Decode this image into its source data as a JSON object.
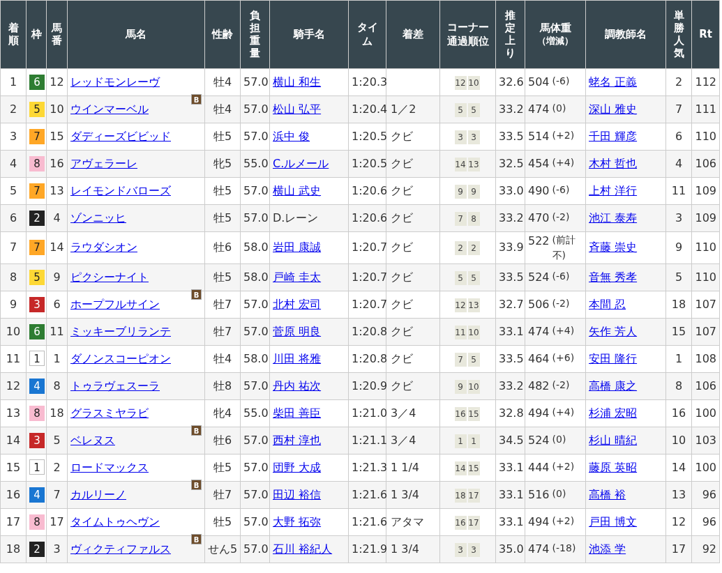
{
  "header": [
    {
      "label": "着順"
    },
    {
      "label": "枠"
    },
    {
      "label": "馬番"
    },
    {
      "label": "馬名"
    },
    {
      "label": "性齢"
    },
    {
      "label": "負担重量"
    },
    {
      "label": "騎手名"
    },
    {
      "label": "タイム"
    },
    {
      "label": "着差"
    },
    {
      "label": "コーナー通過順位"
    },
    {
      "label": "推定上り"
    },
    {
      "label": "馬体重",
      "sub": "（増減）"
    },
    {
      "label": "調教師名"
    },
    {
      "label": "単勝人気"
    },
    {
      "label": "Rt"
    }
  ],
  "rows": [
    {
      "place": "1",
      "frame": "6",
      "color": "#2e7d32",
      "number": "12",
      "horse": "レッドモンレーヴ",
      "sex_age": "牡4",
      "weight": "57.0",
      "jockey": "横山 和生",
      "jockey_linked": true,
      "time": "1:20.3",
      "corners": [
        "12",
        "10"
      ],
      "last_3f": "32.6",
      "body_weight": "504",
      "weight_change": "(-6)",
      "trainer": "蛯名 正義",
      "popularity": "2",
      "rating": "112"
    },
    {
      "place": "2",
      "frame": "5",
      "color": "#fdd835",
      "number": "10",
      "horse": "ウインマーベル",
      "blinkers": "B",
      "sex_age": "牡4",
      "weight": "57.0",
      "jockey": "松山 弘平",
      "jockey_linked": true,
      "time": "1:20.4",
      "margin": "1／2",
      "corners": [
        "5",
        "5"
      ],
      "last_3f": "33.2",
      "body_weight": "474",
      "weight_change": "(0)",
      "trainer": "深山 雅史",
      "popularity": "7",
      "rating": "111"
    },
    {
      "place": "3",
      "frame": "7",
      "color": "#ffa726",
      "number": "15",
      "horse": "ダディーズビビッド",
      "sex_age": "牡5",
      "weight": "57.0",
      "jockey": "浜中 俊",
      "jockey_linked": true,
      "time": "1:20.5",
      "margin": "クビ",
      "corners": [
        "3",
        "3"
      ],
      "last_3f": "33.5",
      "body_weight": "514",
      "weight_change": "(+2)",
      "trainer": "千田 輝彦",
      "popularity": "6",
      "rating": "110"
    },
    {
      "place": "4",
      "frame": "8",
      "color": "#f8bbd0",
      "number": "16",
      "horse": "アヴェラーレ",
      "sex_age": "牝5",
      "weight": "55.0",
      "jockey": "C.ルメール",
      "jockey_linked": true,
      "time": "1:20.5",
      "margin": "クビ",
      "corners": [
        "14",
        "13"
      ],
      "last_3f": "32.5",
      "body_weight": "454",
      "weight_change": "(+4)",
      "trainer": "木村 哲也",
      "popularity": "4",
      "rating": "106"
    },
    {
      "place": "5",
      "frame": "7",
      "color": "#ffa726",
      "number": "13",
      "horse": "レイモンドバローズ",
      "sex_age": "牡5",
      "weight": "57.0",
      "jockey": "横山 武史",
      "jockey_linked": true,
      "time": "1:20.6",
      "margin": "クビ",
      "corners": [
        "9",
        "9"
      ],
      "last_3f": "33.0",
      "body_weight": "490",
      "weight_change": "(-6)",
      "trainer": "上村 洋行",
      "popularity": "11",
      "rating": "109"
    },
    {
      "place": "6",
      "frame": "2",
      "color": "#222222",
      "number": "4",
      "horse": "ゾンニッヒ",
      "sex_age": "牡5",
      "weight": "57.0",
      "jockey": "D.レーン",
      "jockey_linked": false,
      "time": "1:20.6",
      "margin": "クビ",
      "corners": [
        "7",
        "8"
      ],
      "last_3f": "33.2",
      "body_weight": "470",
      "weight_change": "(-2)",
      "trainer": "池江 泰寿",
      "popularity": "3",
      "rating": "109"
    },
    {
      "place": "7",
      "frame": "7",
      "color": "#ffa726",
      "number": "14",
      "horse": "ラウダシオン",
      "sex_age": "牡6",
      "weight": "58.0",
      "jockey": "岩田 康誠",
      "jockey_linked": true,
      "time": "1:20.7",
      "margin": "クビ",
      "corners": [
        "2",
        "2"
      ],
      "last_3f": "33.9",
      "body_weight": "522",
      "weight_change": "(前計不)",
      "trainer": "斉藤 崇史",
      "popularity": "9",
      "rating": "110"
    },
    {
      "place": "8",
      "frame": "5",
      "color": "#fdd835",
      "number": "9",
      "horse": "ピクシーナイト",
      "sex_age": "牡5",
      "weight": "58.0",
      "jockey": "戸崎 圭太",
      "jockey_linked": true,
      "time": "1:20.7",
      "margin": "クビ",
      "corners": [
        "5",
        "5"
      ],
      "last_3f": "33.5",
      "body_weight": "524",
      "weight_change": "(-6)",
      "trainer": "音無 秀孝",
      "popularity": "5",
      "rating": "110"
    },
    {
      "place": "9",
      "frame": "3",
      "color": "#c62828",
      "number": "6",
      "horse": "ホープフルサイン",
      "blinkers": "B",
      "sex_age": "牡7",
      "weight": "57.0",
      "jockey": "北村 宏司",
      "jockey_linked": true,
      "time": "1:20.7",
      "margin": "クビ",
      "corners": [
        "12",
        "13"
      ],
      "last_3f": "32.7",
      "body_weight": "506",
      "weight_change": "(-2)",
      "trainer": "本間 忍",
      "popularity": "18",
      "rating": "107"
    },
    {
      "place": "10",
      "frame": "6",
      "color": "#2e7d32",
      "number": "11",
      "horse": "ミッキーブリランテ",
      "sex_age": "牡7",
      "weight": "57.0",
      "jockey": "菅原 明良",
      "jockey_linked": true,
      "time": "1:20.8",
      "margin": "クビ",
      "corners": [
        "11",
        "10"
      ],
      "last_3f": "33.1",
      "body_weight": "474",
      "weight_change": "(+4)",
      "trainer": "矢作 芳人",
      "popularity": "15",
      "rating": "107"
    },
    {
      "place": "11",
      "frame": "1",
      "color": "#ffffff",
      "number": "1",
      "horse": "ダノンスコーピオン",
      "sex_age": "牡4",
      "weight": "58.0",
      "jockey": "川田 将雅",
      "jockey_linked": true,
      "time": "1:20.8",
      "margin": "クビ",
      "corners": [
        "7",
        "5"
      ],
      "last_3f": "33.5",
      "body_weight": "464",
      "weight_change": "(+6)",
      "trainer": "安田 隆行",
      "popularity": "1",
      "rating": "108"
    },
    {
      "place": "12",
      "frame": "4",
      "color": "#1976d2",
      "number": "8",
      "horse": "トゥラヴェスーラ",
      "sex_age": "牡8",
      "weight": "57.0",
      "jockey": "丹内 祐次",
      "jockey_linked": true,
      "time": "1:20.9",
      "margin": "クビ",
      "corners": [
        "9",
        "10"
      ],
      "last_3f": "33.2",
      "body_weight": "482",
      "weight_change": "(-2)",
      "trainer": "高橋 康之",
      "popularity": "8",
      "rating": "106"
    },
    {
      "place": "13",
      "frame": "8",
      "color": "#f8bbd0",
      "number": "18",
      "horse": "グラスミヤラビ",
      "sex_age": "牝4",
      "weight": "55.0",
      "jockey": "柴田 善臣",
      "jockey_linked": true,
      "time": "1:21.0",
      "margin": "3／4",
      "corners": [
        "16",
        "15"
      ],
      "last_3f": "32.8",
      "body_weight": "494",
      "weight_change": "(+4)",
      "trainer": "杉浦 宏昭",
      "popularity": "16",
      "rating": "100"
    },
    {
      "place": "14",
      "frame": "3",
      "color": "#c62828",
      "number": "5",
      "horse": "ベレヌス",
      "blinkers": "B",
      "sex_age": "牡6",
      "weight": "57.0",
      "jockey": "西村 淳也",
      "jockey_linked": true,
      "time": "1:21.1",
      "margin": "3／4",
      "corners": [
        "1",
        "1"
      ],
      "last_3f": "34.5",
      "body_weight": "524",
      "weight_change": "(0)",
      "trainer": "杉山 晴紀",
      "popularity": "10",
      "rating": "103"
    },
    {
      "place": "15",
      "frame": "1",
      "color": "#ffffff",
      "number": "2",
      "horse": "ロードマックス",
      "sex_age": "牡5",
      "weight": "57.0",
      "jockey": "団野 大成",
      "jockey_linked": true,
      "time": "1:21.3",
      "margin": "1 1/4",
      "corners": [
        "14",
        "15"
      ],
      "last_3f": "33.1",
      "body_weight": "444",
      "weight_change": "(+2)",
      "trainer": "藤原 英昭",
      "popularity": "14",
      "rating": "100"
    },
    {
      "place": "16",
      "frame": "4",
      "color": "#1976d2",
      "number": "7",
      "horse": "カルリーノ",
      "blinkers": "B",
      "sex_age": "牡7",
      "weight": "57.0",
      "jockey": "田辺 裕信",
      "jockey_linked": true,
      "time": "1:21.6",
      "margin": "1 3/4",
      "corners": [
        "18",
        "17"
      ],
      "last_3f": "33.1",
      "body_weight": "516",
      "weight_change": "(0)",
      "trainer": "高橋 裕",
      "popularity": "13",
      "rating": "96"
    },
    {
      "place": "17",
      "frame": "8",
      "color": "#f8bbd0",
      "number": "17",
      "horse": "タイムトゥヘヴン",
      "sex_age": "牡5",
      "weight": "57.0",
      "jockey": "大野 拓弥",
      "jockey_linked": true,
      "time": "1:21.6",
      "margin": "アタマ",
      "corners": [
        "16",
        "17"
      ],
      "last_3f": "33.1",
      "body_weight": "494",
      "weight_change": "(+2)",
      "trainer": "戸田 博文",
      "popularity": "12",
      "rating": "96"
    },
    {
      "place": "18",
      "frame": "2",
      "color": "#222222",
      "number": "3",
      "horse": "ヴィクティファルス",
      "blinkers": "B",
      "sex_age": "せん5",
      "weight": "57.0",
      "jockey": "石川 裕紀人",
      "jockey_linked": true,
      "time": "1:21.9",
      "margin": "1 3/4",
      "corners": [
        "3",
        "3"
      ],
      "last_3f": "35.0",
      "body_weight": "474",
      "weight_change": "(-18)",
      "trainer": "池添 学",
      "popularity": "17",
      "rating": "92"
    }
  ]
}
